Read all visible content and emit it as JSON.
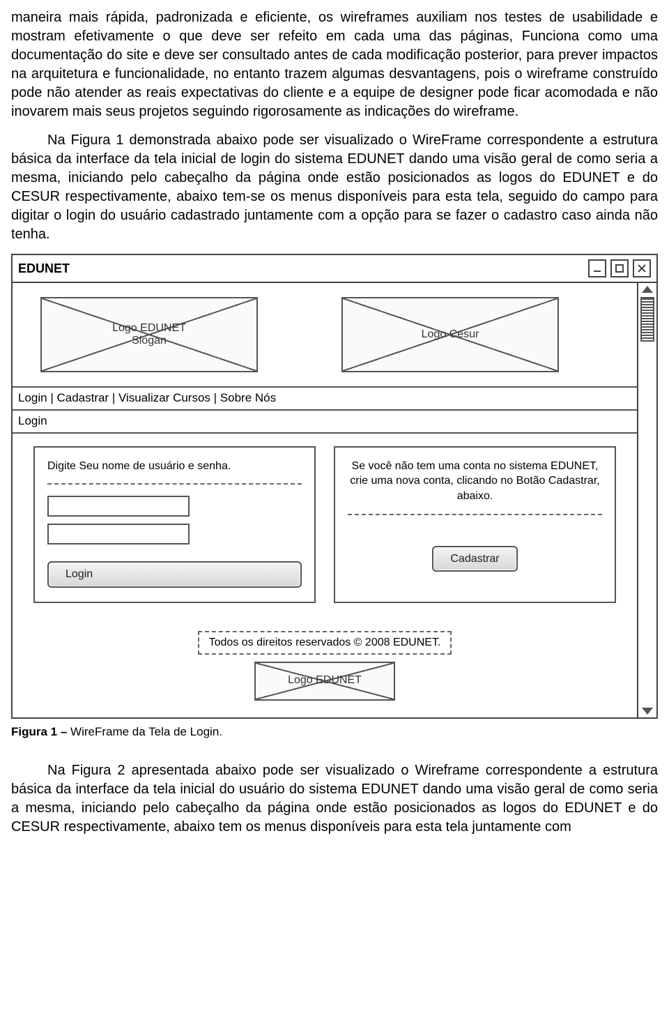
{
  "paragraphs": {
    "p1": "maneira mais rápida, padronizada e eficiente, os wireframes auxiliam nos testes de usabilidade e mostram efetivamente o que deve ser refeito em cada uma das páginas, Funciona como uma documentação do site e deve ser consultado antes de cada modificação posterior, para prever impactos na arquitetura e funcionalidade, no entanto trazem algumas desvantagens, pois o wireframe construído pode não atender as reais expectativas do cliente e a equipe de designer pode ficar acomodada e não inovarem mais seus projetos seguindo rigorosamente as indicações do wireframe.",
    "p2": "Na Figura 1 demonstrada abaixo pode ser visualizado o WireFrame correspondente a estrutura básica da interface da tela inicial de login do sistema EDUNET dando uma visão geral de como seria a mesma, iniciando pelo cabeçalho da  página onde estão posicionados as logos do EDUNET e do CESUR respectivamente, abaixo tem-se os menus disponíveis para esta tela, seguido do campo para digitar o login do usuário cadastrado juntamente com a opção para se fazer o cadastro caso ainda não tenha.",
    "p3": "Na Figura 2 apresentada abaixo pode ser visualizado o Wireframe correspondente a estrutura básica da interface da tela inicial do usuário do sistema EDUNET dando uma visão geral de como seria a mesma, iniciando pelo cabeçalho da página onde estão posicionados as logos do EDUNET e do CESUR respectivamente, abaixo tem os menus disponíveis para esta tela juntamente com"
  },
  "caption": {
    "bold": "Figura 1 – ",
    "rest": "WireFrame da Tela de Login."
  },
  "wireframe": {
    "title": "EDUNET",
    "logo1": "Logo EDUNET\nSlogan",
    "logo2": "Logo Cesur",
    "nav": "Login | Cadastrar | Visualizar Cursos | Sobre Nós",
    "section": "Login",
    "left_prompt": "Digite Seu nome de usuário e senha.",
    "login_btn": "Login",
    "right_text": "Se você não tem uma conta no sistema EDUNET, crie uma nova conta, clicando no Botão Cadastrar, abaixo.",
    "cadastrar_btn": "Cadastrar",
    "footer_text": "Todos os direitos reservados © 2008 EDUNET.",
    "footer_logo": "Logo EDUNET"
  }
}
